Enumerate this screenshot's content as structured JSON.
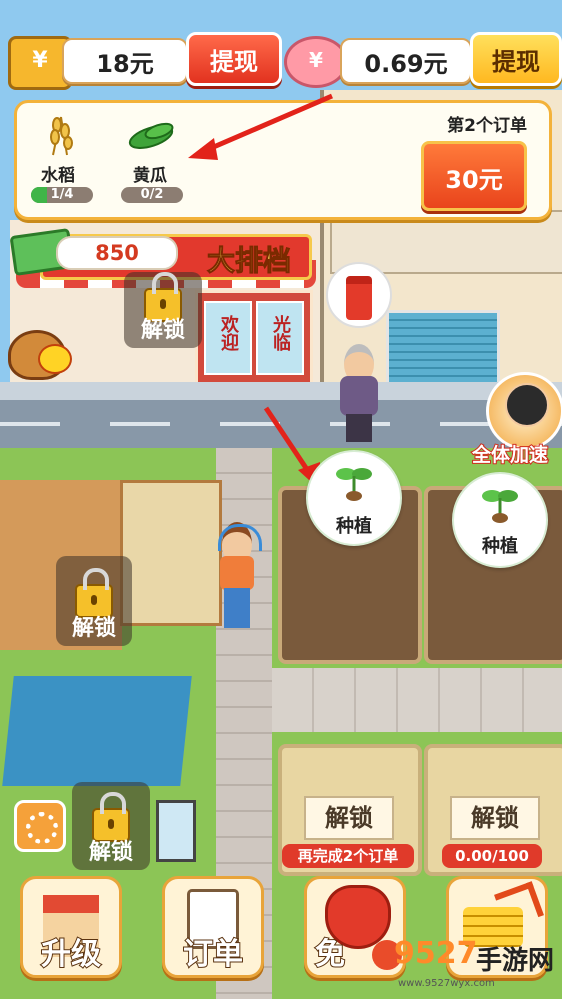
{
  "wallet": {
    "cash_amount": "18元",
    "withdraw_label": "提现",
    "savings_amount": "0.69元",
    "withdraw_label_2": "提现"
  },
  "order": {
    "crops": [
      {
        "name": "水稻",
        "progress_text": "1/4",
        "progress": 0.25
      },
      {
        "name": "黄瓜",
        "progress_text": "0/2",
        "progress": 0
      }
    ],
    "order_title": "第2个订单",
    "reward": "30元"
  },
  "shop": {
    "money": "850",
    "sign": "大排档",
    "door_left": "欢迎",
    "door_right": "光临",
    "unlock_label": "解锁"
  },
  "speedup": {
    "label": "全体加速"
  },
  "plots": {
    "plant_label_1": "种植",
    "plant_label_2": "种植",
    "locked_label_1": "解锁",
    "locked_label_2": "解锁",
    "hint_1": "再完成2个订单",
    "hint_2": "0.00/100"
  },
  "farm": {
    "unlock_label_1": "解锁",
    "unlock_label_2": "解锁"
  },
  "bottom": {
    "upgrade": "升级",
    "orders": "订单",
    "free_prefix": "免",
    "watermark_num": "9527",
    "watermark_text": "手游网",
    "watermark_url": "www.9527wyx.com"
  },
  "colors": {
    "accent_red": "#e2321f",
    "accent_yellow": "#ffb820",
    "panel_border": "#f3b23a",
    "progress_green": "#3fb548"
  }
}
